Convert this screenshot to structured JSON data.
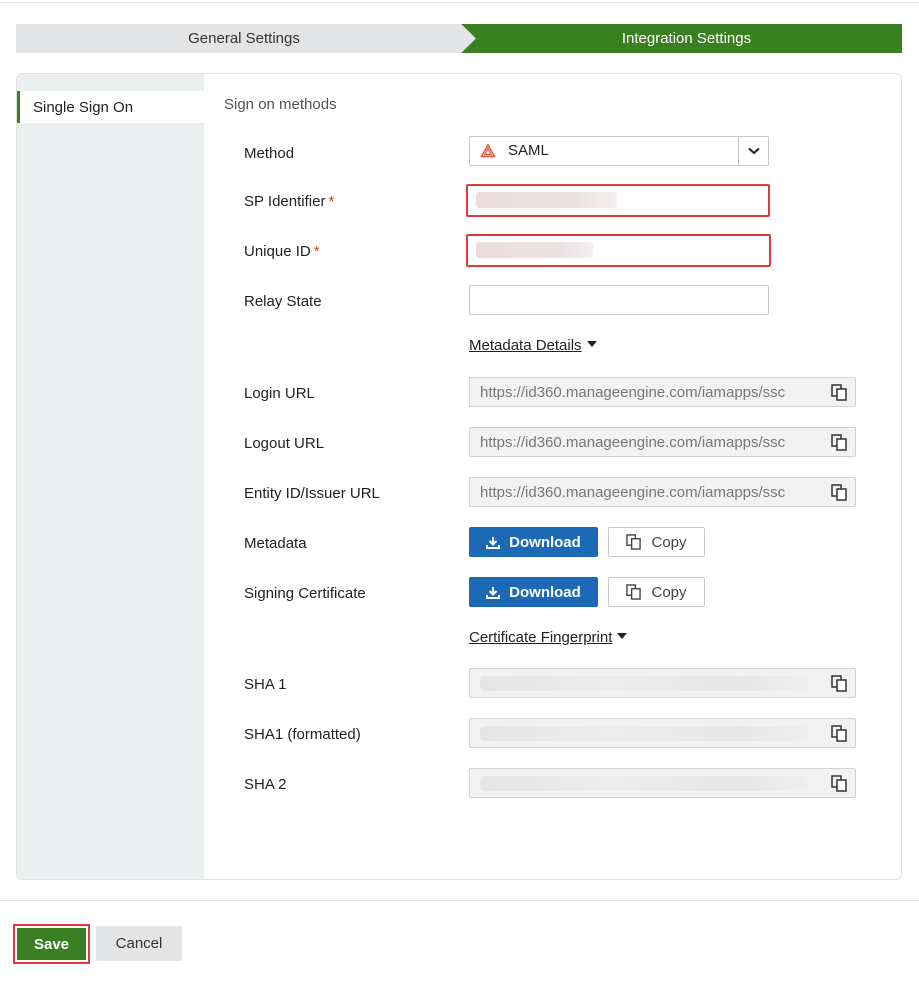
{
  "wizard": {
    "steps": [
      {
        "label": "General Settings",
        "active": false
      },
      {
        "label": "Integration Settings",
        "active": true
      }
    ]
  },
  "sidebar": {
    "items": [
      {
        "label": "Single Sign On",
        "active": true
      }
    ]
  },
  "form": {
    "section_title": "Sign on methods",
    "method": {
      "label": "Method",
      "value": "SAML",
      "icon": "saml-icon"
    },
    "sp_identifier": {
      "label": "SP Identifier",
      "required_mark": "*"
    },
    "unique_id": {
      "label": "Unique ID",
      "required_mark": "*"
    },
    "relay_state": {
      "label": "Relay State",
      "value": ""
    },
    "metadata_details_link": "Metadata Details",
    "login_url": {
      "label": "Login URL",
      "value": "https://id360.manageengine.com/iamapps/ssc"
    },
    "logout_url": {
      "label": "Logout URL",
      "value": "https://id360.manageengine.com/iamapps/ssc"
    },
    "entity_id": {
      "label": "Entity ID/Issuer URL",
      "value": "https://id360.manageengine.com/iamapps/ssc"
    },
    "metadata": {
      "label": "Metadata",
      "download_label": "Download",
      "copy_label": "Copy"
    },
    "signing_certificate": {
      "label": "Signing Certificate",
      "download_label": "Download",
      "copy_label": "Copy"
    },
    "certificate_fingerprint_link": "Certificate Fingerprint",
    "sha1": {
      "label": "SHA 1"
    },
    "sha1_formatted": {
      "label": "SHA1 (formatted)"
    },
    "sha2": {
      "label": "SHA 2"
    }
  },
  "footer": {
    "save_label": "Save",
    "cancel_label": "Cancel"
  },
  "colors": {
    "primary_green": "#3a7f22",
    "download_blue": "#1c6ab5",
    "error_red": "#e03a3a",
    "required_red": "#d9382b"
  }
}
